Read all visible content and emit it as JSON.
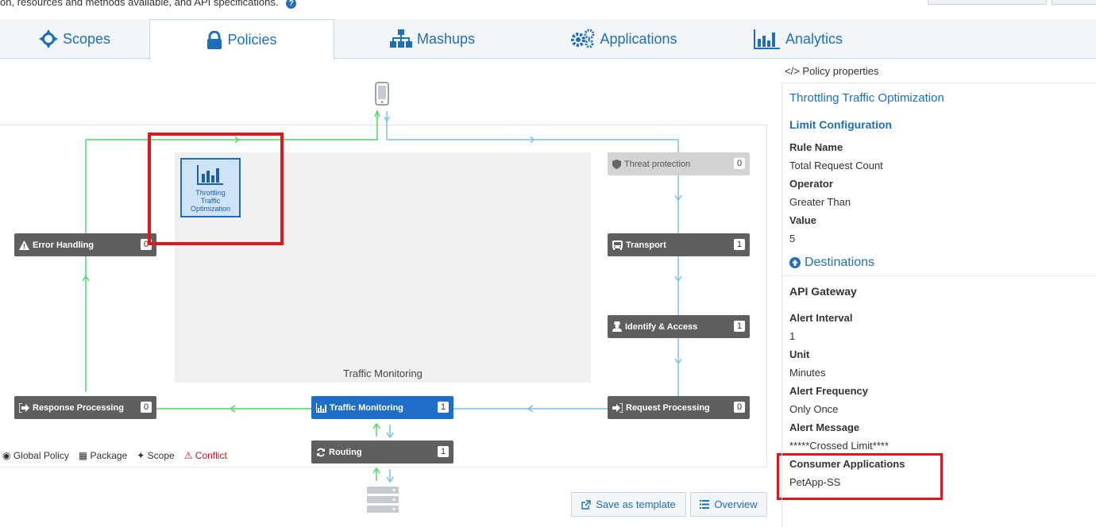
{
  "top": {
    "info_text": "on, resources and methods available, and API specifications."
  },
  "tabs": [
    {
      "label": "Scopes",
      "icon": "scope-icon"
    },
    {
      "label": "Policies",
      "icon": "lock-icon",
      "active": true
    },
    {
      "label": "Mashups",
      "icon": "sitemap-icon"
    },
    {
      "label": "Applications",
      "icon": "gears-icon"
    },
    {
      "label": "Analytics",
      "icon": "bar-chart-icon"
    }
  ],
  "canvas": {
    "policy_area_label": "Traffic Monitoring",
    "policy_tile_label": "Throttling Traffic Optimization",
    "stages": {
      "threat_protection": {
        "label": "Threat protection",
        "count": "0"
      },
      "transport": {
        "label": "Transport",
        "count": "1"
      },
      "identify_access": {
        "label": "Identify & Access",
        "count": "1"
      },
      "request_processing": {
        "label": "Request Processing",
        "count": "0"
      },
      "traffic_monitoring": {
        "label": "Traffic Monitoring",
        "count": "1"
      },
      "routing": {
        "label": "Routing",
        "count": "1"
      },
      "response_processing": {
        "label": "Response Processing",
        "count": "0"
      },
      "error_handling": {
        "label": "Error Handling",
        "count": "0"
      }
    }
  },
  "legend": {
    "global_policy": "Global Policy",
    "package": "Package",
    "scope": "Scope",
    "conflict": "Conflict"
  },
  "buttons": {
    "save_as_template": "Save as template",
    "overview": "Overview"
  },
  "properties": {
    "header": "Policy properties",
    "title": "Throttling Traffic Optimization",
    "limit_configuration": "Limit Configuration",
    "rule_name_label": "Rule Name",
    "rule_name_value": "Total Request Count",
    "operator_label": "Operator",
    "operator_value": "Greater Than",
    "value_label": "Value",
    "value_value": "5",
    "destinations": "Destinations",
    "api_gateway": "API Gateway",
    "alert_interval_label": "Alert Interval",
    "alert_interval_value": "1",
    "unit_label": "Unit",
    "unit_value": "Minutes",
    "alert_frequency_label": "Alert Frequency",
    "alert_frequency_value": "Only Once",
    "alert_message_label": "Alert Message",
    "alert_message_value": "*****Crossed Limit****",
    "consumer_applications_label": "Consumer Applications",
    "consumer_applications_value": "PetApp-SS"
  },
  "colors": {
    "accent": "#1e6fb8",
    "stage_dark": "#5f5f5f",
    "flow_green": "#4cd964",
    "flow_blue": "#7fbfea",
    "highlight_red": "#e0161f",
    "conflict_red": "#d0111b"
  }
}
